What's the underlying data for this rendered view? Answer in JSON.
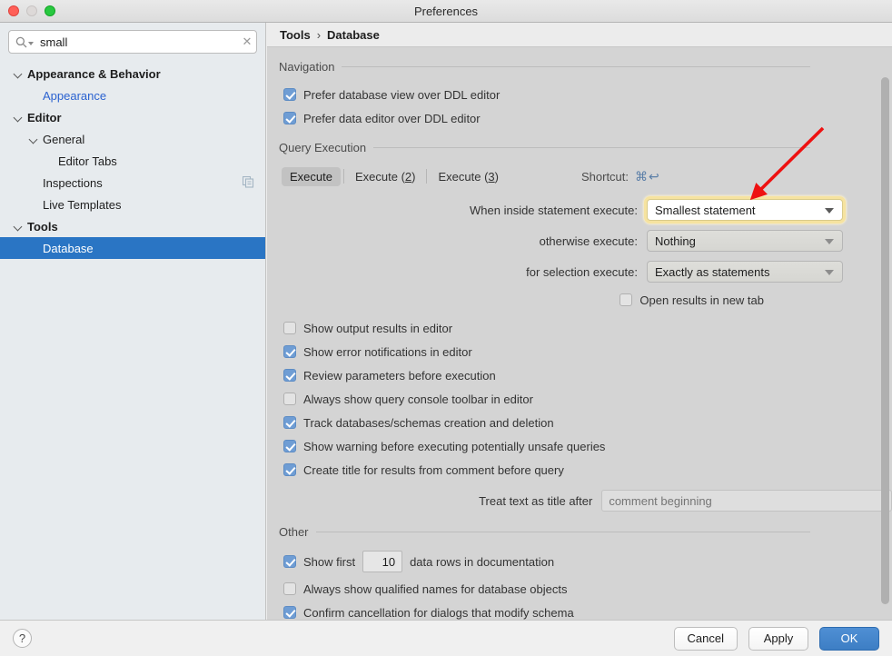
{
  "window": {
    "title": "Preferences",
    "traffic": {
      "close": "close-button",
      "minimize": "minimize-button",
      "maximize": "maximize-button"
    }
  },
  "search": {
    "value": "small",
    "placeholder": "Search settings",
    "clear_label": "✕"
  },
  "sidebar": {
    "items": [
      {
        "label": "Appearance & Behavior",
        "indent": 0,
        "chevron": true,
        "bold": true,
        "selected": false,
        "link": false,
        "icon": null
      },
      {
        "label": "Appearance",
        "indent": 1,
        "chevron": false,
        "bold": false,
        "selected": false,
        "link": true,
        "icon": null
      },
      {
        "label": "Editor",
        "indent": 0,
        "chevron": true,
        "bold": true,
        "selected": false,
        "link": false,
        "icon": null
      },
      {
        "label": "General",
        "indent": 1,
        "chevron": true,
        "bold": false,
        "selected": false,
        "link": false,
        "icon": null
      },
      {
        "label": "Editor Tabs",
        "indent": 2,
        "chevron": false,
        "bold": false,
        "selected": false,
        "link": false,
        "icon": null
      },
      {
        "label": "Inspections",
        "indent": 1,
        "chevron": false,
        "bold": false,
        "selected": false,
        "link": false,
        "icon": "copy-icon"
      },
      {
        "label": "Live Templates",
        "indent": 1,
        "chevron": false,
        "bold": false,
        "selected": false,
        "link": false,
        "icon": null
      },
      {
        "label": "Tools",
        "indent": 0,
        "chevron": true,
        "bold": true,
        "selected": false,
        "link": false,
        "icon": null
      },
      {
        "label": "Database",
        "indent": 1,
        "chevron": false,
        "bold": false,
        "selected": true,
        "link": false,
        "icon": null
      }
    ]
  },
  "breadcrumb": {
    "root": "Tools",
    "separator": "›",
    "leaf": "Database"
  },
  "sections": {
    "navigation": {
      "title": "Navigation",
      "checkboxes": [
        {
          "label": "Prefer database view over DDL editor",
          "checked": true
        },
        {
          "label": "Prefer data editor over DDL editor",
          "checked": true
        }
      ]
    },
    "query_execution": {
      "title": "Query Execution",
      "tabs": [
        {
          "label": "Execute",
          "active": true
        },
        {
          "label": "Execute (2)",
          "active": false
        },
        {
          "label": "Execute (3)",
          "active": false
        }
      ],
      "shortcut_label": "Shortcut:",
      "shortcut_keys": "⌘↩",
      "combos": [
        {
          "label": "When inside statement execute:",
          "value": "Smallest statement",
          "focused": true
        },
        {
          "label": "otherwise execute:",
          "value": "Nothing",
          "focused": false
        },
        {
          "label": "for selection execute:",
          "value": "Exactly as statements",
          "focused": false
        }
      ],
      "open_new_tab": {
        "label": "Open results in new tab",
        "checked": false
      },
      "checkboxes": [
        {
          "label": "Show output results in editor",
          "checked": false
        },
        {
          "label": "Show error notifications in editor",
          "checked": true
        },
        {
          "label": "Review parameters before execution",
          "checked": true
        },
        {
          "label": "Always show query console toolbar in editor",
          "checked": false
        },
        {
          "label": "Track databases/schemas creation and deletion",
          "checked": true
        },
        {
          "label": "Show warning before executing potentially unsafe queries",
          "checked": true
        },
        {
          "label": "Create title for results from comment before query",
          "checked": true
        }
      ],
      "title_after": {
        "label": "Treat text as title after",
        "value": "",
        "placeholder": "comment beginning"
      }
    },
    "other": {
      "title": "Other",
      "show_first": {
        "checked": true,
        "prefix": "Show first",
        "count": "10",
        "suffix": "data rows in documentation"
      },
      "checkboxes": [
        {
          "label": "Always show qualified names for database objects",
          "checked": false
        },
        {
          "label": "Confirm cancellation for dialogs that modify schema",
          "checked": true
        }
      ]
    }
  },
  "footer": {
    "help": "?",
    "cancel": "Cancel",
    "apply": "Apply",
    "ok": "OK"
  },
  "annotation": {
    "arrow_color": "#ee1111"
  },
  "colors": {
    "selection_blue": "#2a75c4",
    "link_blue": "#2b62d0",
    "checkbox_blue": "#6f9dd4",
    "focus_yellow": "#f6e3a0",
    "ok_blue": "#3d7ec4"
  }
}
